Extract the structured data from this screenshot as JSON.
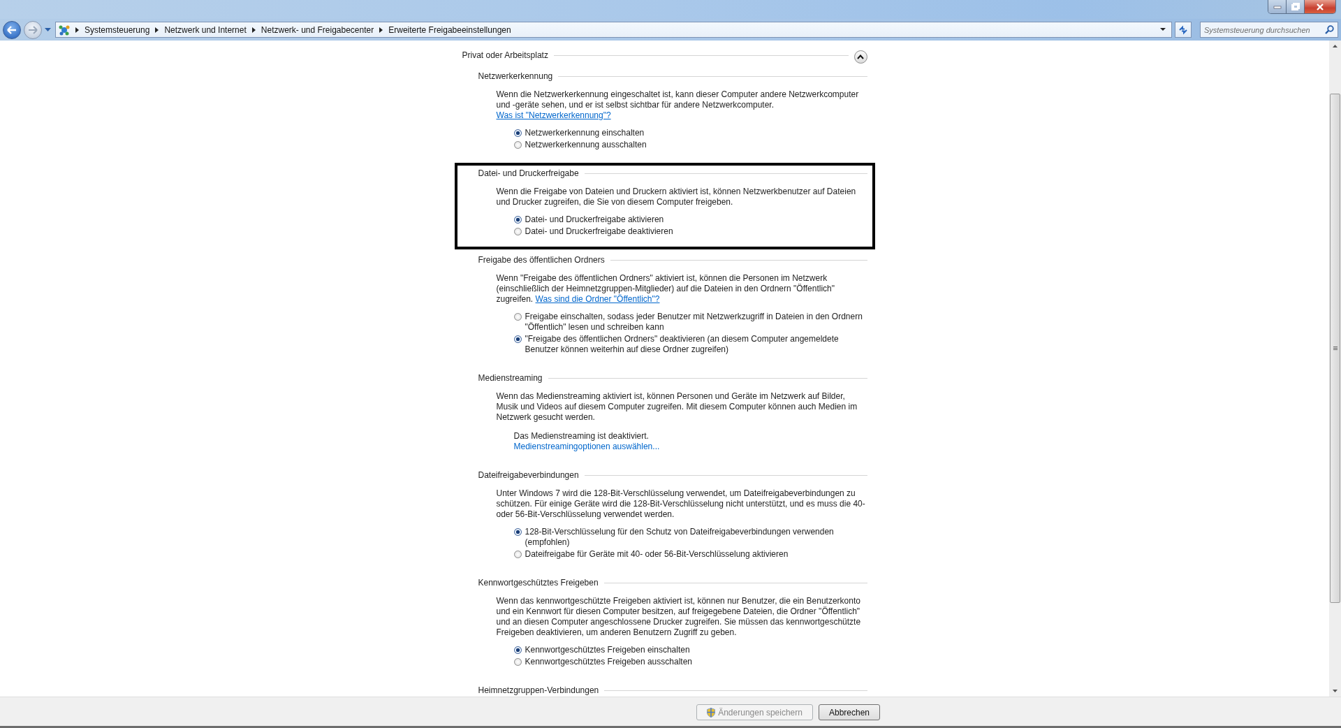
{
  "address_bar": {
    "breadcrumb": [
      "Systemsteuerung",
      "Netzwerk und Internet",
      "Netzwerk- und Freigabecenter",
      "Erweiterte Freigabeeinstellungen"
    ]
  },
  "search": {
    "placeholder": "Systemsteuerung durchsuchen"
  },
  "profile": {
    "title": "Privat oder Arbeitsplatz",
    "expanded": true
  },
  "sections": [
    {
      "kind": "radios",
      "title": "Netzwerkerkennung",
      "highlighted": false,
      "text": "Wenn die Netzwerkerkennung eingeschaltet ist, kann dieser Computer andere Netzwerkcomputer und -geräte sehen, und er ist selbst sichtbar für andere Netzwerkcomputer.",
      "link": "Was ist \"Netzwerkerkennung\"?",
      "options": [
        {
          "label": "Netzwerkerkennung einschalten",
          "selected": true
        },
        {
          "label": "Netzwerkerkennung ausschalten",
          "selected": false
        }
      ]
    },
    {
      "kind": "radios",
      "title": "Datei- und Druckerfreigabe",
      "highlighted": true,
      "text": "Wenn die Freigabe von Dateien und Druckern aktiviert ist, können Netzwerkbenutzer auf Dateien und Drucker zugreifen, die Sie von diesem Computer freigeben.",
      "options": [
        {
          "label": "Datei- und Druckerfreigabe aktivieren",
          "selected": true
        },
        {
          "label": "Datei- und Druckerfreigabe deaktivieren",
          "selected": false
        }
      ]
    },
    {
      "kind": "radios",
      "title": "Freigabe des öffentlichen Ordners",
      "highlighted": false,
      "text": "Wenn \"Freigabe des öffentlichen Ordners\" aktiviert ist, können die Personen im Netzwerk (einschließlich der Heimnetzgruppen-Mitglieder) auf die Dateien in den Ordnern \"Öffentlich\" zugreifen.",
      "link": "Was sind die Ordner \"Öffentlich\"?",
      "options": [
        {
          "label": "Freigabe einschalten, sodass jeder Benutzer mit Netzwerkzugriff in Dateien in den Ordnern \"Öffentlich\" lesen und schreiben kann",
          "selected": false
        },
        {
          "label": "\"Freigabe des öffentlichen Ordners\" deaktivieren (an diesem Computer angemeldete Benutzer können weiterhin auf diese Ordner zugreifen)",
          "selected": true
        }
      ]
    },
    {
      "kind": "status",
      "title": "Medienstreaming",
      "highlighted": false,
      "text": "Wenn das Medienstreaming aktiviert ist, können Personen und Geräte im Netzwerk auf Bilder, Musik und Videos auf diesem Computer zugreifen. Mit diesem Computer können auch Medien im Netzwerk gesucht werden.",
      "status": "Das Medienstreaming ist deaktiviert.",
      "action": "Medienstreamingoptionen auswählen..."
    },
    {
      "kind": "radios",
      "title": "Dateifreigabeverbindungen",
      "highlighted": false,
      "text": "Unter Windows 7 wird die 128-Bit-Verschlüsselung verwendet, um Dateifreigabeverbindungen zu schützen. Für einige Geräte wird die 128-Bit-Verschlüsselung nicht unterstützt, und es muss die 40- oder 56-Bit-Verschlüsselung verwendet werden.",
      "options": [
        {
          "label": "128-Bit-Verschlüsselung für den Schutz von Dateifreigabeverbindungen verwenden (empfohlen)",
          "selected": true
        },
        {
          "label": "Dateifreigabe für Geräte mit 40- oder 56-Bit-Verschlüsselung aktivieren",
          "selected": false
        }
      ]
    },
    {
      "kind": "radios",
      "title": "Kennwortgeschütztes Freigeben",
      "highlighted": false,
      "text": "Wenn das kennwortgeschützte Freigeben aktiviert ist, können nur Benutzer, die ein Benutzerkonto und ein Kennwort für diesen Computer besitzen, auf freigegebene Dateien, die Ordner \"Öffentlich\" und an diesen Computer angeschlossene Drucker zugreifen. Sie müssen das kennwortgeschützte Freigeben deaktivieren, um anderen Benutzern Zugriff zu geben.",
      "options": [
        {
          "label": "Kennwortgeschütztes Freigeben einschalten",
          "selected": true
        },
        {
          "label": "Kennwortgeschütztes Freigeben ausschalten",
          "selected": false
        }
      ]
    },
    {
      "kind": "heading",
      "title": "Heimnetzgruppen-Verbindungen",
      "highlighted": false
    }
  ],
  "buttons": [
    {
      "label": "Änderungen speichern",
      "disabled": true,
      "shield": true
    },
    {
      "label": "Abbrechen",
      "disabled": false,
      "shield": false
    }
  ]
}
